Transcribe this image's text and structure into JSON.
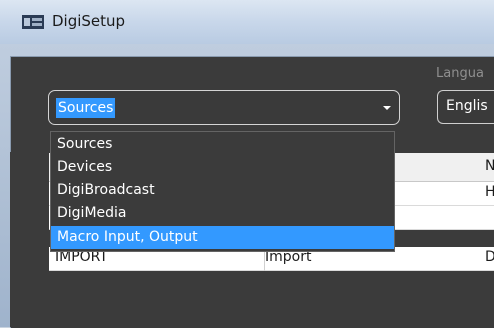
{
  "window": {
    "title": "DigiSetup"
  },
  "language": {
    "label": "Langua",
    "value": "Englis"
  },
  "main_select": {
    "value": "Sources"
  },
  "dropdown": {
    "items": [
      {
        "label": "Sources"
      },
      {
        "label": "Devices"
      },
      {
        "label": "DigiBroadcast"
      },
      {
        "label": "DigiMedia"
      },
      {
        "label": "Macro Input, Output"
      }
    ],
    "highlighted_index": 4
  },
  "grid": {
    "header_partial": "N",
    "rows": [
      {
        "c1": "",
        "c2": "",
        "c3": "H"
      },
      {
        "c1": "",
        "c2": "",
        "c3": ""
      },
      {
        "c1": "IMPORT",
        "c2": "Import",
        "c3": "D"
      }
    ]
  },
  "colors": {
    "selection": "#3399ff",
    "dark_panel": "#3b3b3b"
  }
}
